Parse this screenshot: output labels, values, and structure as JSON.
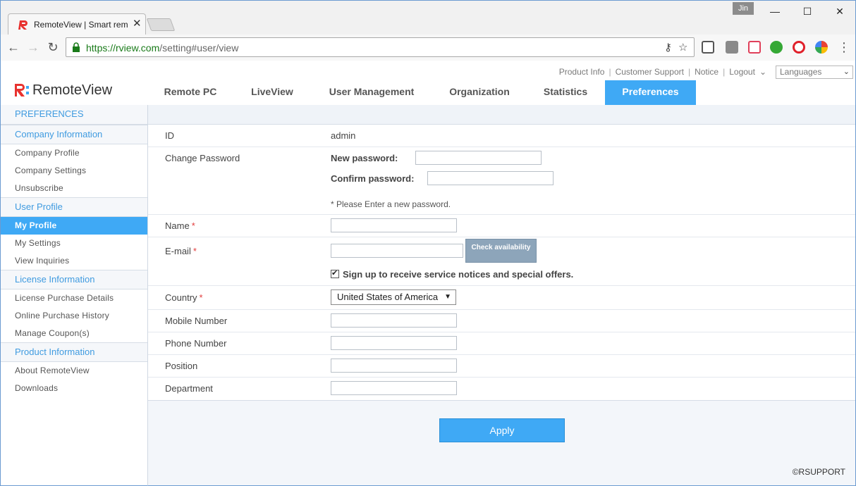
{
  "browser": {
    "tab_title": "RemoteView | Smart rem",
    "url_host": "https://rview.com",
    "url_path": "/setting#user/view",
    "user_badge": "Jin"
  },
  "header": {
    "links": [
      "Product Info",
      "Customer Support",
      "Notice",
      "Logout"
    ],
    "language_select": "Languages",
    "logo_text": "RemoteView",
    "nav": [
      "Remote PC",
      "LiveView",
      "User Management",
      "Organization",
      "Statistics",
      "Preferences"
    ],
    "active_nav": "Preferences"
  },
  "sidebar": {
    "title": "PREFERENCES",
    "sections": [
      {
        "heading": "Company Information",
        "items": [
          "Company Profile",
          "Company Settings",
          "Unsubscribe"
        ]
      },
      {
        "heading": "User Profile",
        "items": [
          "My Profile",
          "My Settings",
          "View Inquiries"
        ]
      },
      {
        "heading": "License Information",
        "items": [
          "License Purchase Details",
          "Online Purchase History",
          "Manage Coupon(s)"
        ]
      },
      {
        "heading": "Product Information",
        "items": [
          "About RemoteView",
          "Downloads"
        ]
      }
    ],
    "active_item": "My Profile"
  },
  "form": {
    "id_label": "ID",
    "id_value": "admin",
    "change_password_label": "Change Password",
    "new_password_label": "New password:",
    "new_password_value": "",
    "confirm_password_label": "Confirm password:",
    "confirm_password_value": "",
    "password_note": "* Please Enter a new password.",
    "name_label": "Name",
    "name_value": "",
    "email_label": "E-mail",
    "email_value": "",
    "check_availability": "Check availability",
    "newsletter_label": "Sign up to receive service notices and special offers.",
    "newsletter_checked": true,
    "country_label": "Country",
    "country_value": "United States of America",
    "mobile_label": "Mobile Number",
    "mobile_value": "",
    "phone_label": "Phone Number",
    "phone_value": "",
    "position_label": "Position",
    "position_value": "",
    "department_label": "Department",
    "department_value": "",
    "required_mark": "*"
  },
  "apply_label": "Apply",
  "copyright": "©RSUPPORT",
  "colors": {
    "accent": "#3fa9f5",
    "required": "#e23c3c",
    "brand_red": "#e8322f"
  }
}
